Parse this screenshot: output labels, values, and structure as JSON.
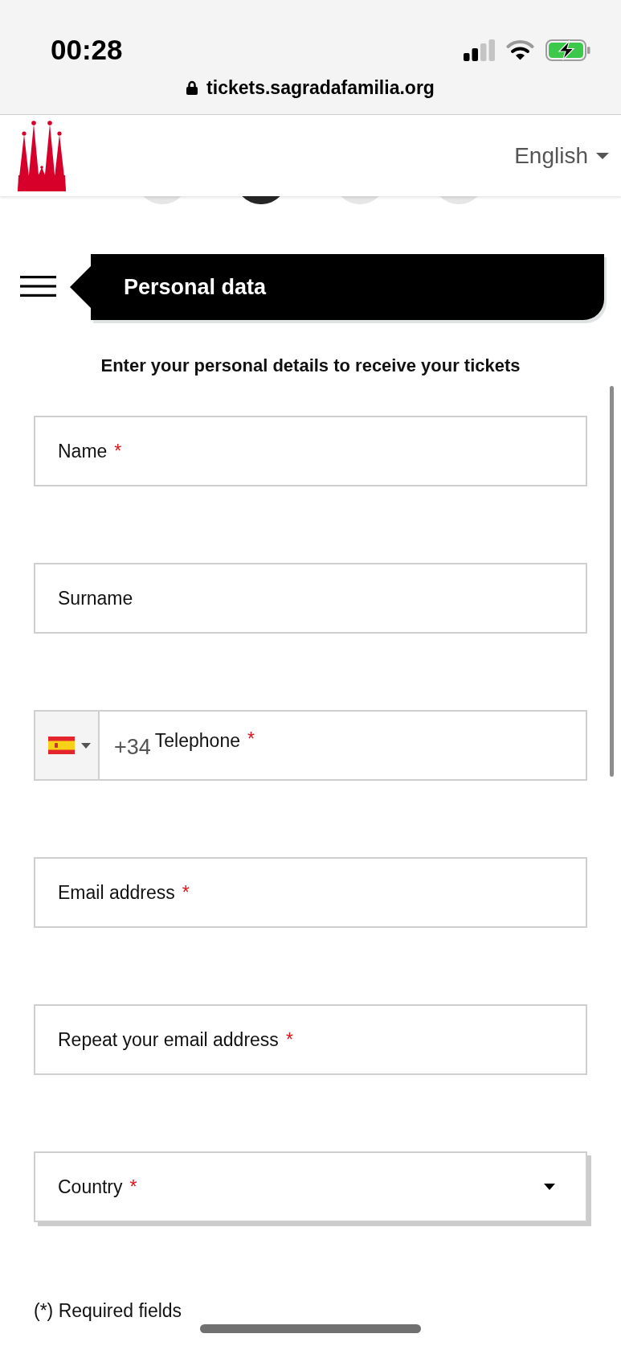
{
  "status_bar": {
    "time": "00:28",
    "url": "tickets.sagradafamilia.org"
  },
  "header": {
    "language": "English"
  },
  "steps": [
    {
      "selected": false
    },
    {
      "selected": true
    },
    {
      "selected": false
    },
    {
      "selected": false
    }
  ],
  "section": {
    "title": "Personal data"
  },
  "intro": "Enter your personal details to receive your tickets",
  "fields": [
    {
      "kind": "text",
      "label": "Name",
      "mark": "*"
    },
    {
      "kind": "text",
      "label": "Surname"
    },
    {
      "kind": "phone",
      "prefix": "+34",
      "label": "Telephone",
      "mark": "*"
    },
    {
      "kind": "text",
      "label": "Email address",
      "mark": "*"
    },
    {
      "kind": "text",
      "label": "Repeat your email address",
      "mark": "*"
    },
    {
      "kind": "select",
      "label": "Country",
      "mark": "*"
    }
  ],
  "footnote": "(*) Required fields"
}
